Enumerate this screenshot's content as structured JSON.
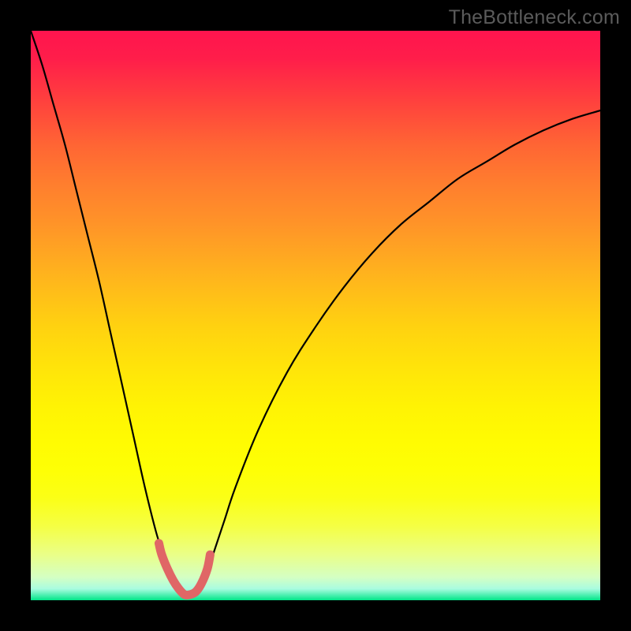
{
  "watermark": "TheBottleneck.com",
  "colors": {
    "frame": "#000000",
    "curve": "#000000",
    "highlight": "#e06666",
    "gradient_top": "#ff144e",
    "gradient_bottom": "#00e588"
  },
  "chart_data": {
    "type": "line",
    "title": "",
    "xlabel": "",
    "ylabel": "",
    "xlim": [
      0,
      100
    ],
    "ylim": [
      0,
      100
    ],
    "note": "No axis ticks or numeric labels are rendered; values estimated from pixel positions on a 0–100 normalized grid. y=0 is bottom (green), y=100 is top (red). Curve resembles a V-shaped bottleneck profile with minimum near x≈27.",
    "series": [
      {
        "name": "bottleneck-curve",
        "x": [
          0,
          2,
          4,
          6,
          8,
          10,
          12,
          14,
          16,
          18,
          20,
          22,
          23,
          24,
          25,
          26,
          27,
          28,
          29,
          30,
          31,
          32,
          34,
          36,
          40,
          45,
          50,
          55,
          60,
          65,
          70,
          75,
          80,
          85,
          90,
          95,
          100
        ],
        "y": [
          100,
          94,
          87,
          80,
          72,
          64,
          56,
          47,
          38,
          29,
          20,
          12,
          9,
          6.5,
          4,
          2,
          1,
          1,
          1.5,
          3,
          5,
          8,
          14,
          20,
          30,
          40,
          48,
          55,
          61,
          66,
          70,
          74,
          77,
          80,
          82.5,
          84.5,
          86
        ]
      },
      {
        "name": "highlight-segment",
        "x": [
          22.5,
          23,
          24,
          25,
          26,
          27,
          28,
          29,
          30,
          31,
          31.5
        ],
        "y": [
          10,
          8,
          5.5,
          3.5,
          2,
          1,
          1,
          1.5,
          3,
          5.5,
          8
        ]
      }
    ]
  }
}
